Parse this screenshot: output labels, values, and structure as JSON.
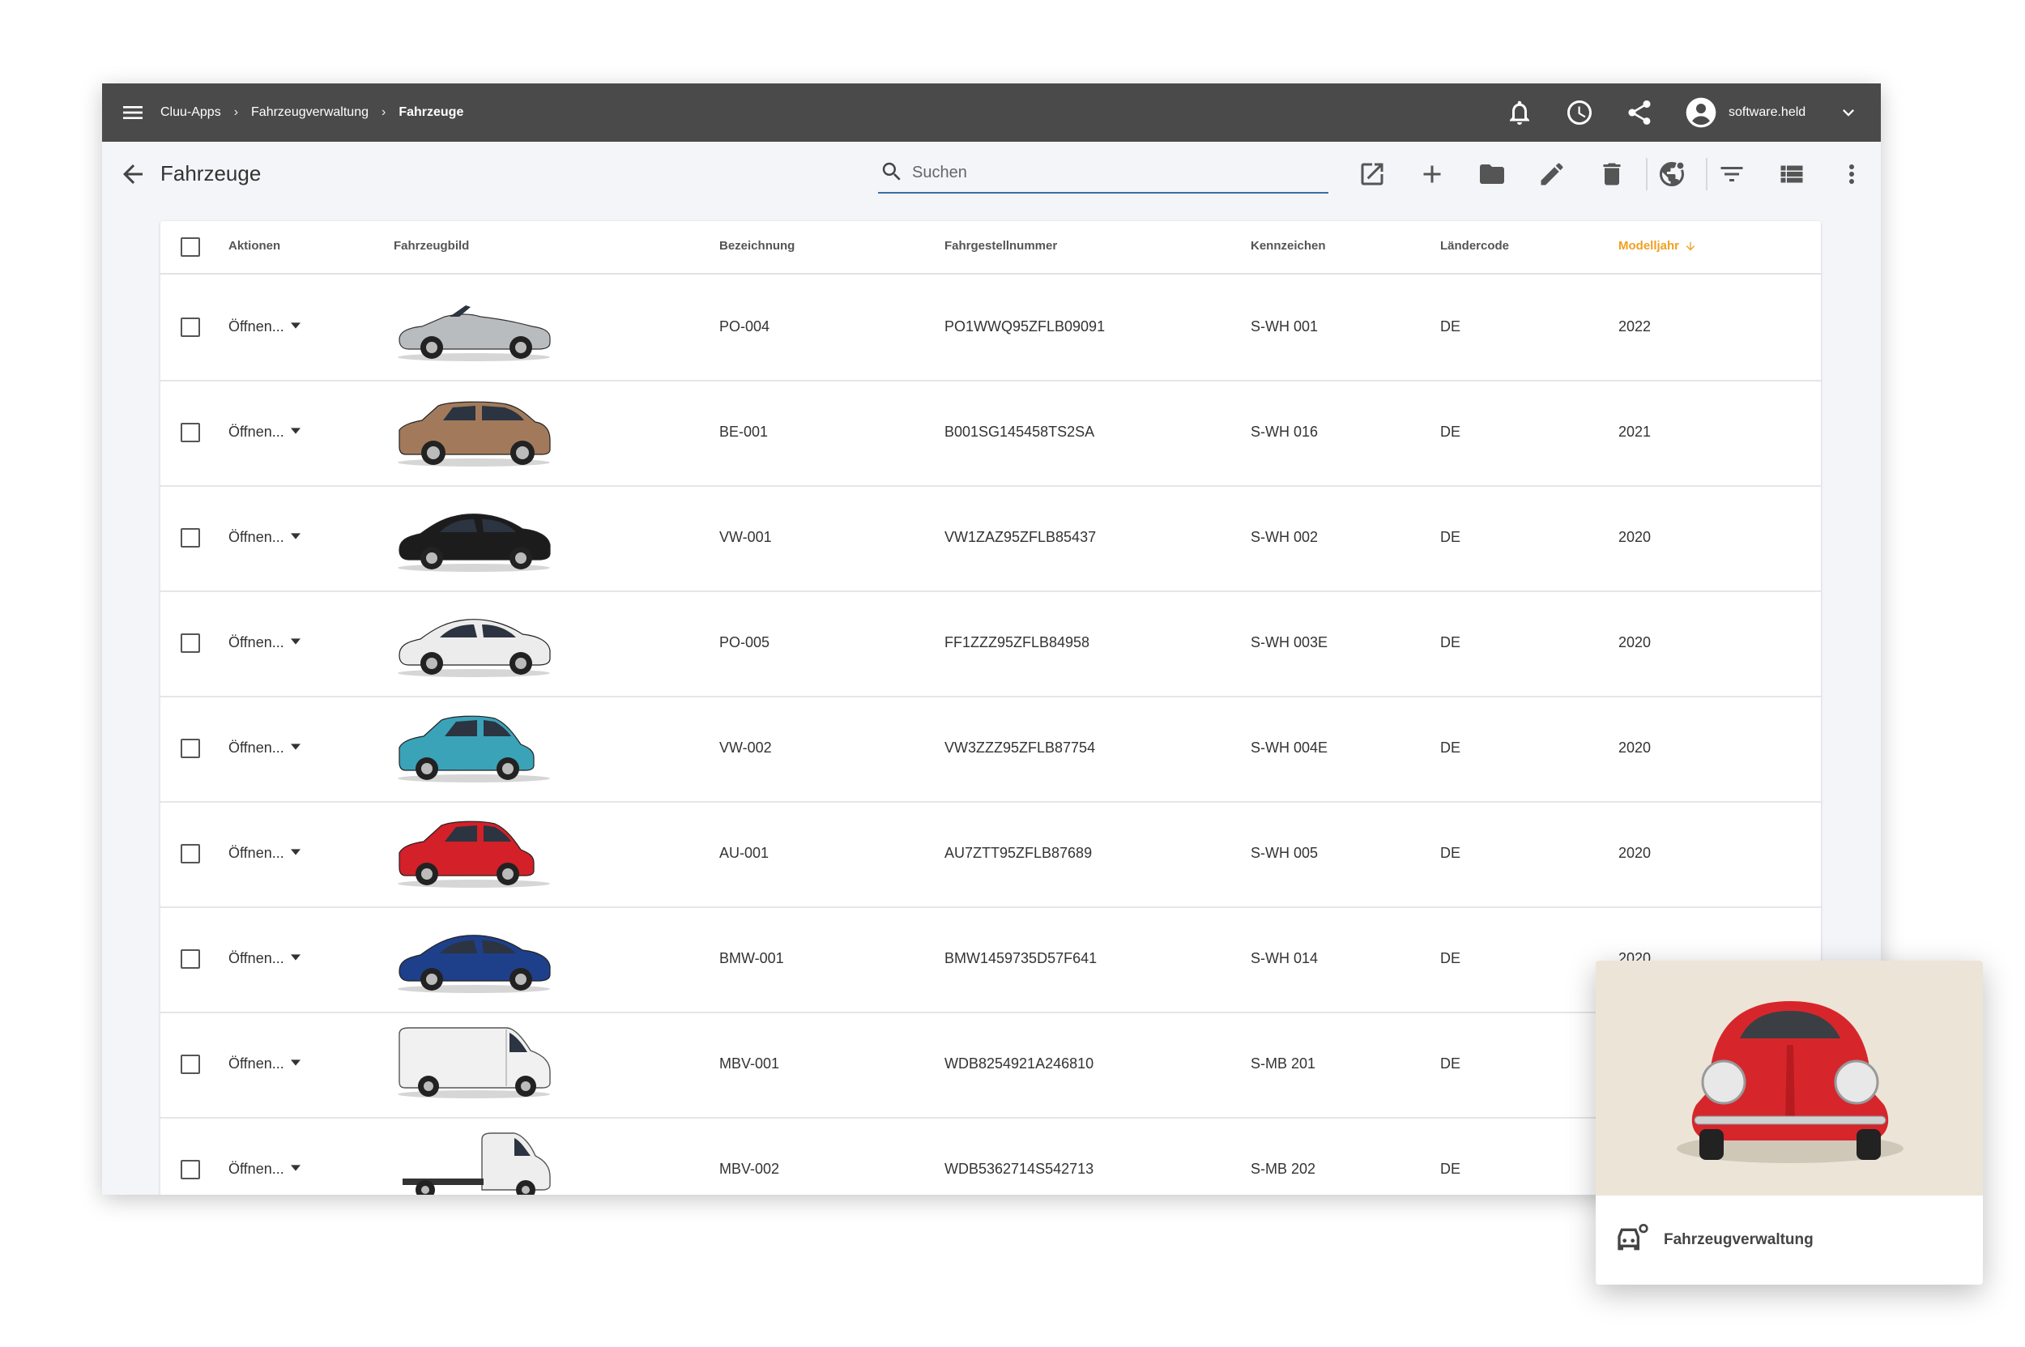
{
  "header": {
    "breadcrumbs": [
      "Cluu-Apps",
      "Fahrzeugverwaltung",
      "Fahrzeuge"
    ],
    "username": "software.held",
    "icons": [
      "menu-icon",
      "bell-icon",
      "clock-icon",
      "share-icon",
      "account-circle-icon",
      "chevron-down-icon"
    ]
  },
  "toolbar": {
    "title": "Fahrzeuge",
    "search_placeholder": "Suchen",
    "search_value": "",
    "actions": [
      "open-in-new-icon",
      "plus-icon",
      "folder-icon",
      "pencil-icon",
      "trash-icon",
      "globe-settings-icon",
      "filter-icon",
      "list-view-icon",
      "more-vert-icon"
    ]
  },
  "table": {
    "columns": [
      "Aktionen",
      "Fahrzeugbild",
      "Bezeichnung",
      "Fahrgestellnummer",
      "Kennzeichen",
      "Ländercode",
      "Modelljahr"
    ],
    "sorted_column": "Modelljahr",
    "sort_direction": "descending",
    "open_label": "Öffnen...",
    "rows": [
      {
        "bezeichnung": "PO-004",
        "fin": "PO1WWQ95ZFLB09091",
        "kennzeichen": "S-WH 001",
        "land": "DE",
        "jahr": "2022",
        "car": "silver-convertible",
        "color": "#b9bcbf"
      },
      {
        "bezeichnung": "BE-001",
        "fin": "B001SG145458TS2SA",
        "kennzeichen": "S-WH 016",
        "land": "DE",
        "jahr": "2021",
        "car": "bronze-suv",
        "color": "#a27a5b"
      },
      {
        "bezeichnung": "VW-001",
        "fin": "VW1ZAZ95ZFLB85437",
        "kennzeichen": "S-WH 002",
        "land": "DE",
        "jahr": "2020",
        "car": "black-sedan",
        "color": "#1c1c1c"
      },
      {
        "bezeichnung": "PO-005",
        "fin": "FF1ZZZ95ZFLB84958",
        "kennzeichen": "S-WH 003E",
        "land": "DE",
        "jahr": "2020",
        "car": "white-sports-sedan",
        "color": "#ececec"
      },
      {
        "bezeichnung": "VW-002",
        "fin": "VW3ZZZ95ZFLB87754",
        "kennzeichen": "S-WH 004E",
        "land": "DE",
        "jahr": "2020",
        "car": "teal-hatchback",
        "color": "#3aa3b8"
      },
      {
        "bezeichnung": "AU-001",
        "fin": "AU7ZTT95ZFLB87689",
        "kennzeichen": "S-WH 005",
        "land": "DE",
        "jahr": "2020",
        "car": "red-hatchback",
        "color": "#d42028"
      },
      {
        "bezeichnung": "BMW-001",
        "fin": "BMW1459735D57F641",
        "kennzeichen": "S-WH 014",
        "land": "DE",
        "jahr": "2020",
        "car": "blue-coupe",
        "color": "#1e3f8a"
      },
      {
        "bezeichnung": "MBV-001",
        "fin": "WDB8254921A246810",
        "kennzeichen": "S-MB 201",
        "land": "DE",
        "jahr": "",
        "car": "white-van",
        "color": "#f1f1f1"
      },
      {
        "bezeichnung": "MBV-002",
        "fin": "WDB5362714S542713",
        "kennzeichen": "S-MB 202",
        "land": "DE",
        "jahr": "",
        "car": "white-chassis-truck",
        "color": "#eeeeee"
      }
    ]
  },
  "app_tile": {
    "label": "Fahrzeugverwaltung",
    "icon": "car-settings-icon",
    "image": "red-beetle-front",
    "image_background": "#ece5d7",
    "car_color": "#d7262b"
  }
}
